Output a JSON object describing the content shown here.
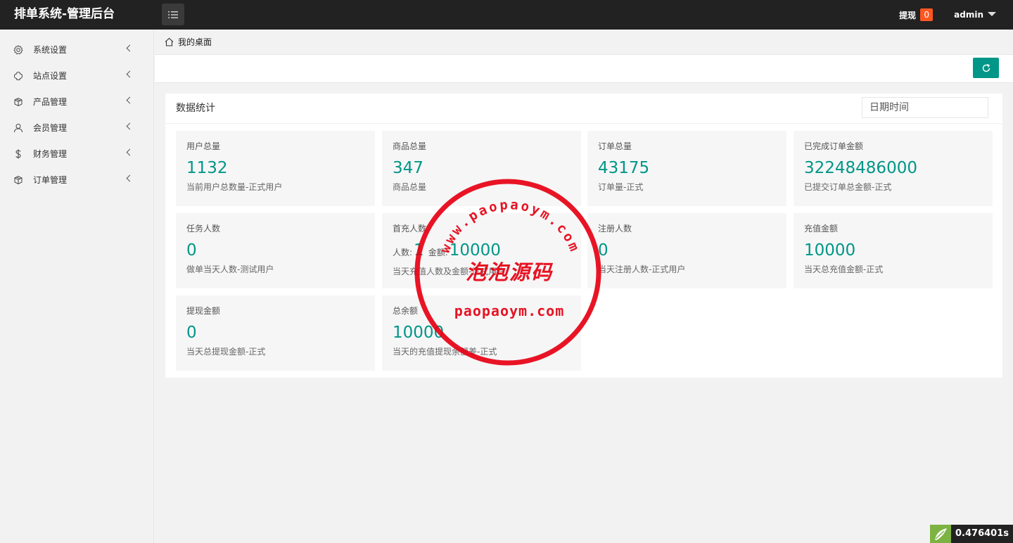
{
  "app": {
    "title": "排单系统-管理后台"
  },
  "header": {
    "withdraw_label": "提现",
    "withdraw_count": "0",
    "user_name": "admin"
  },
  "sidebar": {
    "items": [
      {
        "label": "系统设置",
        "icon": "gear-icon"
      },
      {
        "label": "站点设置",
        "icon": "cloud-icon"
      },
      {
        "label": "产品管理",
        "icon": "cube-icon"
      },
      {
        "label": "会员管理",
        "icon": "user-icon"
      },
      {
        "label": "财务管理",
        "icon": "dollar-icon"
      },
      {
        "label": "订单管理",
        "icon": "cube-icon"
      }
    ]
  },
  "breadcrumb": {
    "label": "我的桌面"
  },
  "panel": {
    "title": "数据统计",
    "date_placeholder": "日期时间"
  },
  "stats": [
    {
      "title": "用户总量",
      "value": "1132",
      "desc": "当前用户总数量-正式用户"
    },
    {
      "title": "商品总量",
      "value": "347",
      "desc": "商品总量"
    },
    {
      "title": "订单总量",
      "value": "43175",
      "desc": "订单量-正式"
    },
    {
      "title": "已完成订单金额",
      "value": "32248486000",
      "desc": "已提交订单总金额-正式"
    },
    {
      "title": "任务人数",
      "value": "0",
      "desc": "做单当天人数-测试用户"
    },
    {
      "title": "首充人数",
      "count_label": "人数:",
      "count": "1",
      "amount_label": "金额:",
      "amount": "10000",
      "desc": "当天充值人数及金额-正式用户"
    },
    {
      "title": "注册人数",
      "value": "0",
      "desc": "当天注册人数-正式用户"
    },
    {
      "title": "充值金额",
      "value": "10000",
      "desc": "当天总充值金额-正式"
    },
    {
      "title": "提现金额",
      "value": "0",
      "desc": "当天总提现金额-正式"
    },
    {
      "title": "总余额",
      "value": "10000",
      "desc": "当天的充值提现余额差-正式"
    }
  ],
  "watermark": {
    "arc_text": "www.paopaoym.com",
    "center_text": "泡泡源码",
    "bottom_text": "paopaoym.com",
    "color": "#e60012"
  },
  "timer": {
    "value": "0.476401s"
  },
  "colors": {
    "accent": "#009688",
    "badge": "#ff5722",
    "header": "#222222"
  }
}
